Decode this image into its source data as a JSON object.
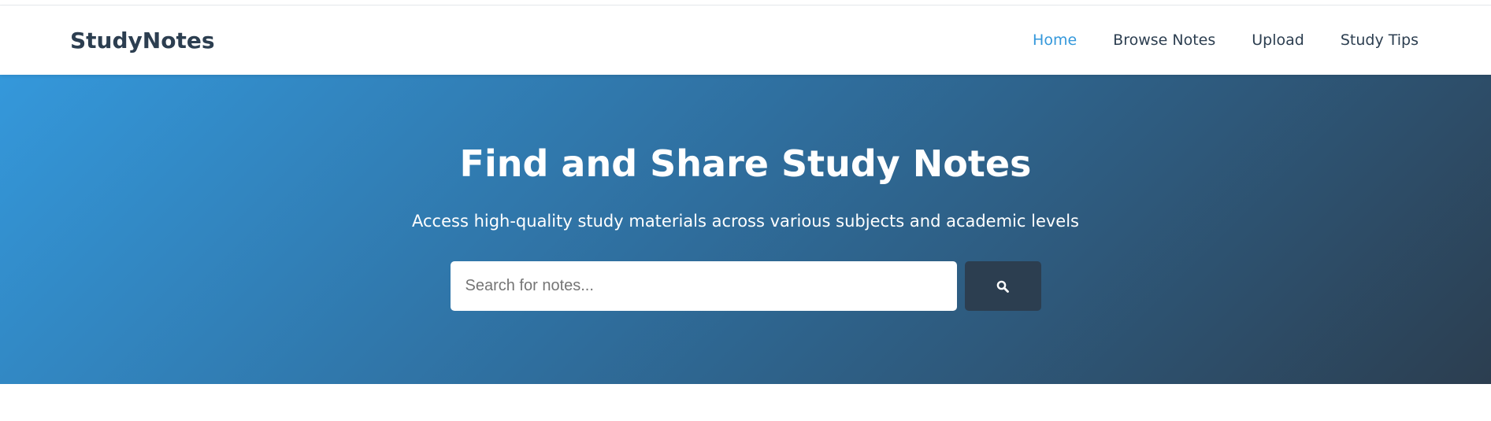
{
  "header": {
    "brand": "StudyNotes",
    "nav": [
      {
        "label": "Home",
        "active": true
      },
      {
        "label": "Browse Notes",
        "active": false
      },
      {
        "label": "Upload",
        "active": false
      },
      {
        "label": "Study Tips",
        "active": false
      }
    ]
  },
  "hero": {
    "title": "Find and Share Study Notes",
    "subtitle": "Access high-quality study materials across various subjects and academic levels",
    "search": {
      "placeholder": "Search for notes...",
      "value": "",
      "button_icon": "search-icon"
    }
  },
  "colors": {
    "brand_text": "#2c3e50",
    "accent": "#3498db",
    "hero_gradient_start": "#3498db",
    "hero_gradient_end": "#2c3e50",
    "search_button": "#2c3e50"
  }
}
